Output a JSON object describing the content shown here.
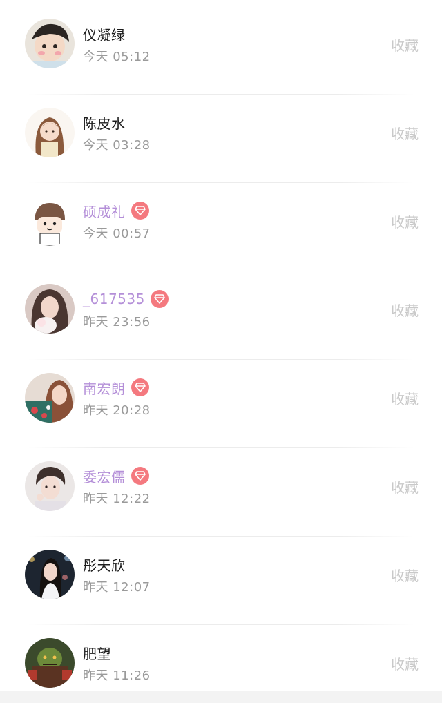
{
  "list": {
    "favorite_label": "收藏",
    "items": [
      {
        "name": "仪凝绿",
        "time": "今天 05:12",
        "vip": false,
        "avatar": "avatar-girl-cartoon-icon"
      },
      {
        "name": "陈皮水",
        "time": "今天 03:28",
        "vip": false,
        "avatar": "avatar-girl-drawing-icon"
      },
      {
        "name": "硕成礼",
        "time": "今天 00:57",
        "vip": true,
        "avatar": "avatar-cartoon-boy-icon"
      },
      {
        "name": "_617535",
        "time": "昨天 23:56",
        "vip": true,
        "avatar": "avatar-girl-photo-icon"
      },
      {
        "name": "南宏朗",
        "time": "昨天 20:28",
        "vip": true,
        "avatar": "avatar-girl-photo-icon"
      },
      {
        "name": "委宏儒",
        "time": "昨天 12:22",
        "vip": true,
        "avatar": "avatar-boy-photo-icon"
      },
      {
        "name": "彤天欣",
        "time": "昨天 12:07",
        "vip": false,
        "avatar": "avatar-girl-night-photo-icon"
      },
      {
        "name": "肥望",
        "time": "昨天 11:26",
        "vip": false,
        "avatar": "avatar-game-character-icon"
      }
    ]
  },
  "colors": {
    "vip_name": "#b48fd8",
    "vip_badge": "#f4797f",
    "normal_name": "#1c1c1c",
    "time_text": "#9a9a9a",
    "favorite_text": "#c9c9c9"
  }
}
